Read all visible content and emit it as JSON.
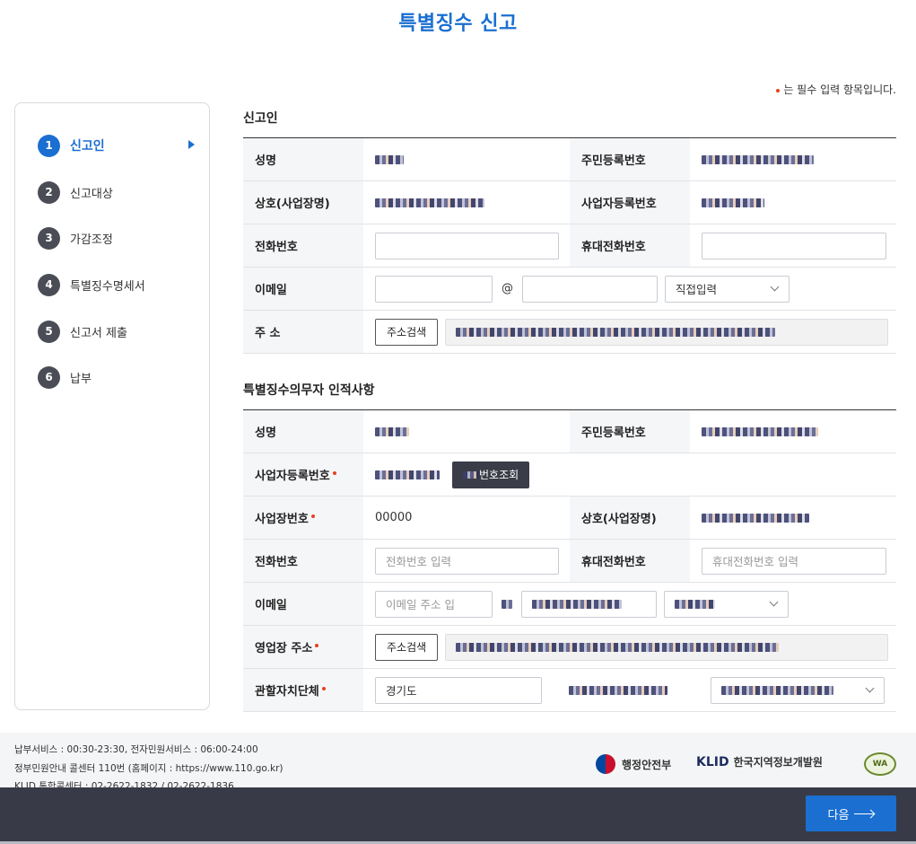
{
  "page": {
    "title": "특별징수 신고",
    "required_note": "는 필수 입력 항목입니다."
  },
  "steps": [
    {
      "num": "1",
      "label": "신고인",
      "active": true
    },
    {
      "num": "2",
      "label": "신고대상"
    },
    {
      "num": "3",
      "label": "가감조정"
    },
    {
      "num": "4",
      "label": "특별징수명세서"
    },
    {
      "num": "5",
      "label": "신고서 제출"
    },
    {
      "num": "6",
      "label": "납부"
    }
  ],
  "reporter": {
    "title": "신고인",
    "name_label": "성명",
    "rrn_label": "주민등록번호",
    "company_label": "상호(사업장명)",
    "bizno_label": "사업자등록번호",
    "phone_label": "전화번호",
    "mobile_label": "휴대전화번호",
    "email_label": "이메일",
    "email_at": "@",
    "email_domain_select": "직접입력",
    "address_label": "주 소",
    "address_button": "주소검색"
  },
  "agent": {
    "title": "특별징수의무자 인적사항",
    "name_label": "성명",
    "rrn_label": "주민등록번호",
    "bizno_label": "사업자등록번호",
    "bizno_button": "번호조회",
    "workplace_no_label": "사업장번호",
    "workplace_no_value": "00000",
    "company_label": "상호(사업장명)",
    "phone_label": "전화번호",
    "phone_placeholder": "전화번호 입력",
    "mobile_label": "휴대전화번호",
    "mobile_placeholder": "휴대전화번호 입력",
    "email_label": "이메일",
    "email_placeholder": "이메일 주소 입",
    "address_label": "영업장 주소",
    "address_button": "주소검색",
    "gov_label": "관할자치단체",
    "gov_select": "경기도"
  },
  "footer": {
    "line1": "납부서비스 : 00:30-23:30, 전자민원서비스 : 06:00-24:00",
    "line2": "정부민원안내 콜센터 110번 (홈페이지 : https://www.110.go.kr)",
    "line3": "KLID 통합콜센터 : 02-2622-1832 / 02-2622-1836",
    "logo1": "행정안전부",
    "logo2_mark": "KLID",
    "logo2": "한국지역정보개발원",
    "logo3": "WA"
  },
  "actions": {
    "next": "다음"
  },
  "colors": {
    "accent": "#1a6fd1",
    "required": "#e8411e",
    "bottom_bar": "#383a47"
  },
  "icons": {
    "step_arrow": "triangle-right-icon",
    "select_chevron": "chevron-down-icon",
    "next_arrow": "arrow-right-icon"
  }
}
